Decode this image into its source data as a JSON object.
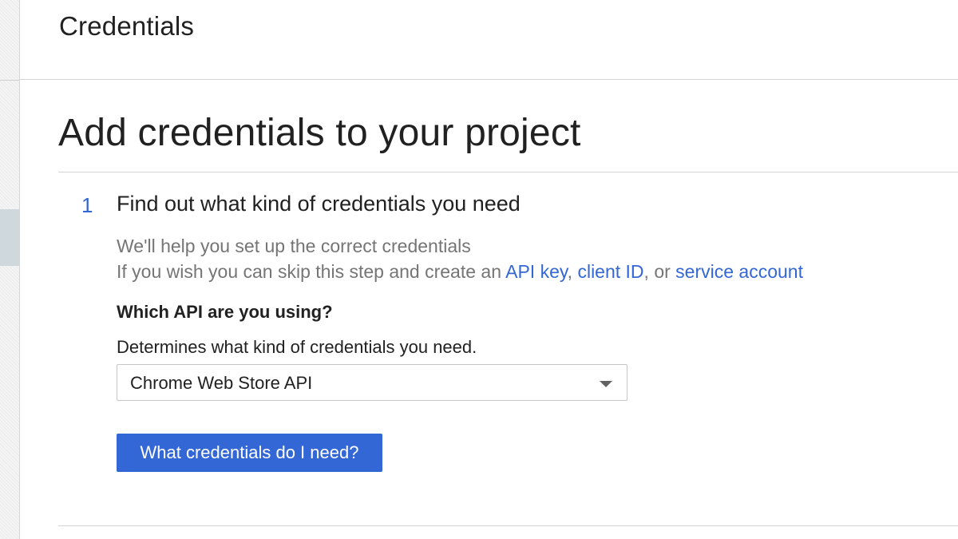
{
  "header": {
    "title": "Credentials"
  },
  "main": {
    "title": "Add credentials to your project",
    "step": {
      "number": "1",
      "title": "Find out what kind of credentials you need",
      "help_line1": "We'll help you set up the correct credentials",
      "help_line2_prefix": "If you wish you can skip this step and create an",
      "link_api_key": "API key",
      "sep1": ",",
      "link_client_id": "client ID",
      "sep2": ", or",
      "link_service_account": "service account",
      "question_label": "Which API are you using?",
      "question_hint": "Determines what kind of credentials you need.",
      "api_select": {
        "selected": "Chrome Web Store API"
      },
      "button_label": "What credentials do I need?"
    }
  },
  "colors": {
    "accent": "#3367d6",
    "text_primary": "#212121",
    "text_secondary": "#757575",
    "divider": "#d3d3d3"
  },
  "icons": {
    "dropdown": "caret-down-icon"
  }
}
